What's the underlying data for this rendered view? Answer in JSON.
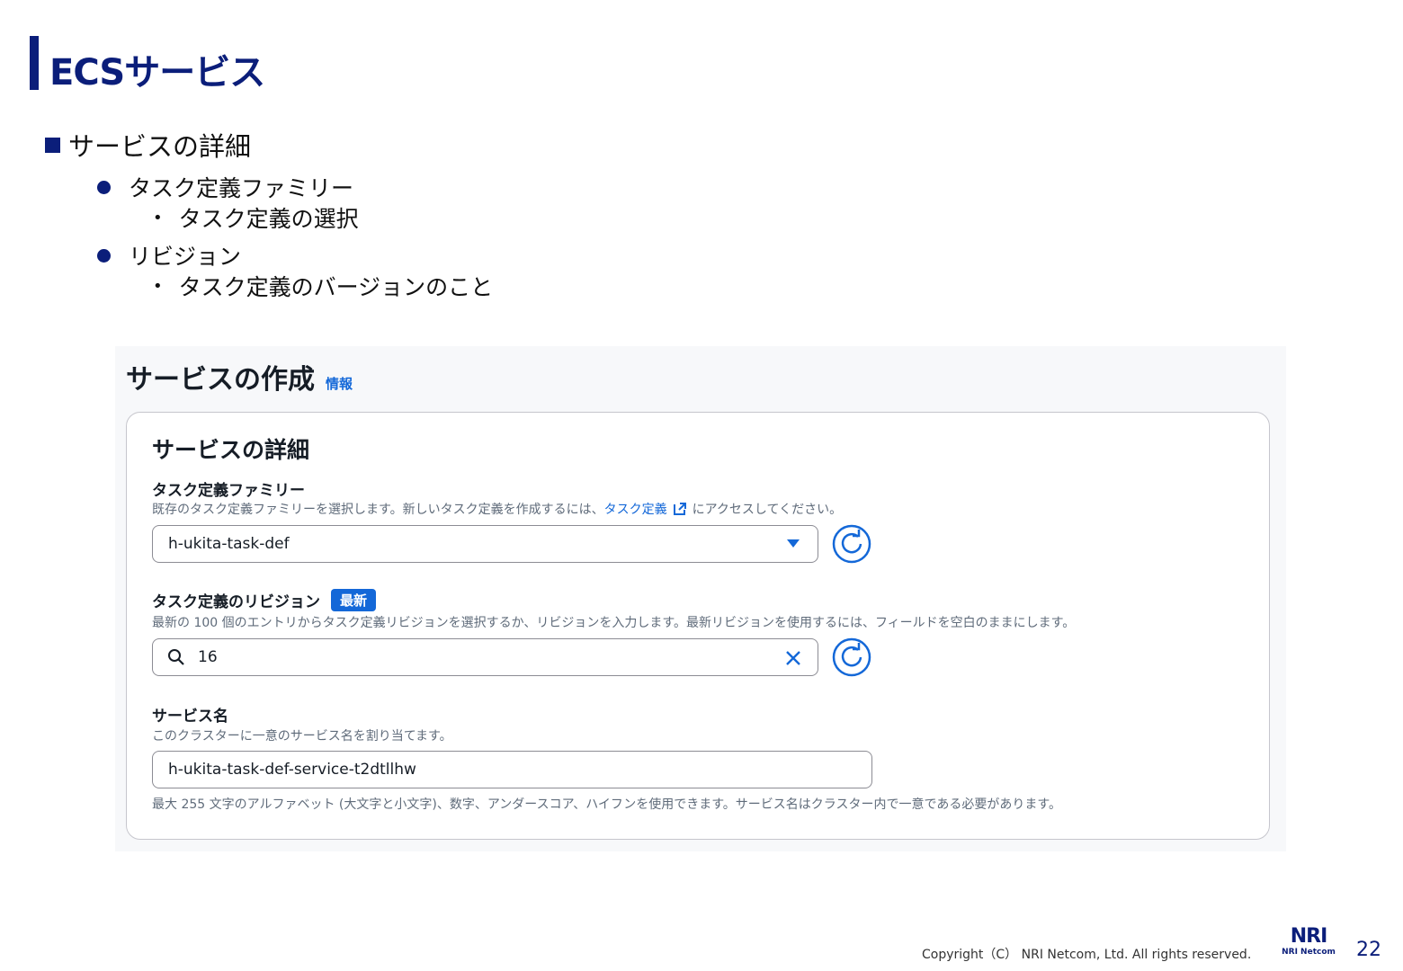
{
  "slide": {
    "title": "ECSサービス",
    "sections": {
      "heading": "サービスの詳細",
      "item1": "タスク定義ファミリー",
      "item1_sub": "タスク定義の選択",
      "item2": "リビジョン",
      "item2_sub": "タスク定義のバージョンのこと"
    },
    "copyright": "Copyright（C） NRI Netcom, Ltd. All rights reserved.",
    "logo_text_big": "NRI",
    "logo_text_small": "NRI Netcom",
    "page_number": "22"
  },
  "console": {
    "page_title": "サービスの作成",
    "info_link": "情報",
    "card_title": "サービスの詳細",
    "task_family": {
      "label": "タスク定義ファミリー",
      "desc_before": "既存のタスク定義ファミリーを選択します。新しいタスク定義を作成するには、",
      "desc_link": "タスク定義",
      "desc_after": "にアクセスしてください。",
      "value": "h-ukita-task-def"
    },
    "revision": {
      "label": "タスク定義のリビジョン",
      "badge": "最新",
      "desc": "最新の 100 個のエントリからタスク定義リビジョンを選択するか、リビジョンを入力します。最新リビジョンを使用するには、フィールドを空白のままにします。",
      "value": "16"
    },
    "service_name": {
      "label": "サービス名",
      "desc": "このクラスターに一意のサービス名を割り当てます。",
      "value": "h-ukita-task-def-service-t2dtllhw",
      "constraint": "最大 255 文字のアルファベット (大文字と小文字)、数字、アンダースコア、ハイフンを使用できます。サービス名はクラスター内で一意である必要があります。"
    },
    "colors": {
      "accent": "#1468d8",
      "brand": "#0b1e7a"
    },
    "icons": [
      "external-link-icon",
      "caret-down-icon",
      "refresh-icon",
      "search-icon",
      "clear-icon"
    ]
  }
}
